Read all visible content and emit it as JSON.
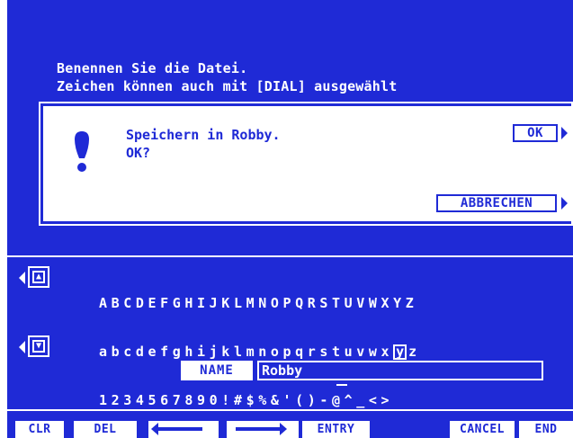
{
  "instructions": {
    "line1": "Benennen Sie die Datei.",
    "line2": "Zeichen können auch mit [DIAL] ausgewählt"
  },
  "dialog": {
    "message_line1": "Speichern in Robby.",
    "message_line2": "OK?",
    "ok_label": "OK",
    "cancel_label": "ABBRECHEN",
    "icon": "exclamation-icon"
  },
  "charset": {
    "row1": "ABCDEFGHIJKLMNOPQRSTUVWXYZ",
    "row2_before": "abcdefghijklmnopqrstuvwx",
    "row2_selected": "y",
    "row2_after": "z",
    "row3": "1234567890!#$%&'()-@^_<>",
    "up_button_icon": "page-up-icon",
    "down_button_icon": "page-down-icon"
  },
  "name_field": {
    "label": "NAME",
    "value": "Robby"
  },
  "function_keys": {
    "clr": "CLR",
    "del": "DEL",
    "left_icon": "left-arrow-icon",
    "right_icon": "right-arrow-icon",
    "entry": "ENTRY",
    "cancel": "CANCEL",
    "end": "END"
  },
  "colors": {
    "background": "#1f2ad6",
    "foreground": "#ffffff"
  }
}
